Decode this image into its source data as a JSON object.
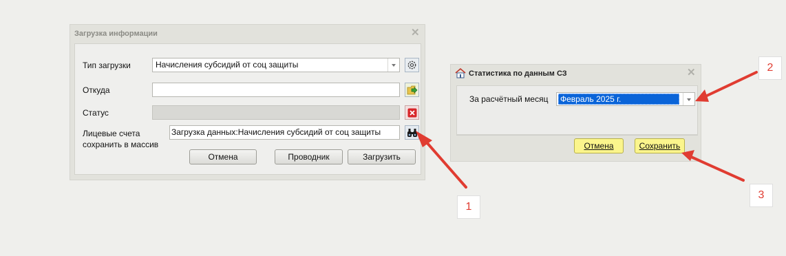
{
  "dialog1": {
    "title": "Загрузка информации",
    "load_type_label": "Тип загрузки",
    "load_type_value": "Начисления субсидий от соц защиты",
    "from_label": "Откуда",
    "from_value": "",
    "status_label": "Статус",
    "status_value": "",
    "accounts_label_1": "Лицевые счета",
    "accounts_label_2": "сохранить  в массив",
    "accounts_value": "Загрузка данных:Начисления субсидий от соц защиты",
    "cancel": "Отмена",
    "explorer": "Проводник",
    "load": "Загрузить",
    "icons": {
      "settings": "gear-icon",
      "open": "folder-arrow-icon",
      "clear": "red-x-icon",
      "find": "binoculars-icon"
    }
  },
  "dialog2": {
    "title": "Статистика по данным СЗ",
    "month_label": "За расчётный месяц",
    "month_value": "Февраль 2025 г.",
    "cancel": "Отмена",
    "save": "Сохранить"
  },
  "callouts": [
    "1",
    "2",
    "3"
  ],
  "colors": {
    "arrow": "#e03c31",
    "selection": "#0a64d8",
    "yellow_button": "#fbf58c"
  }
}
